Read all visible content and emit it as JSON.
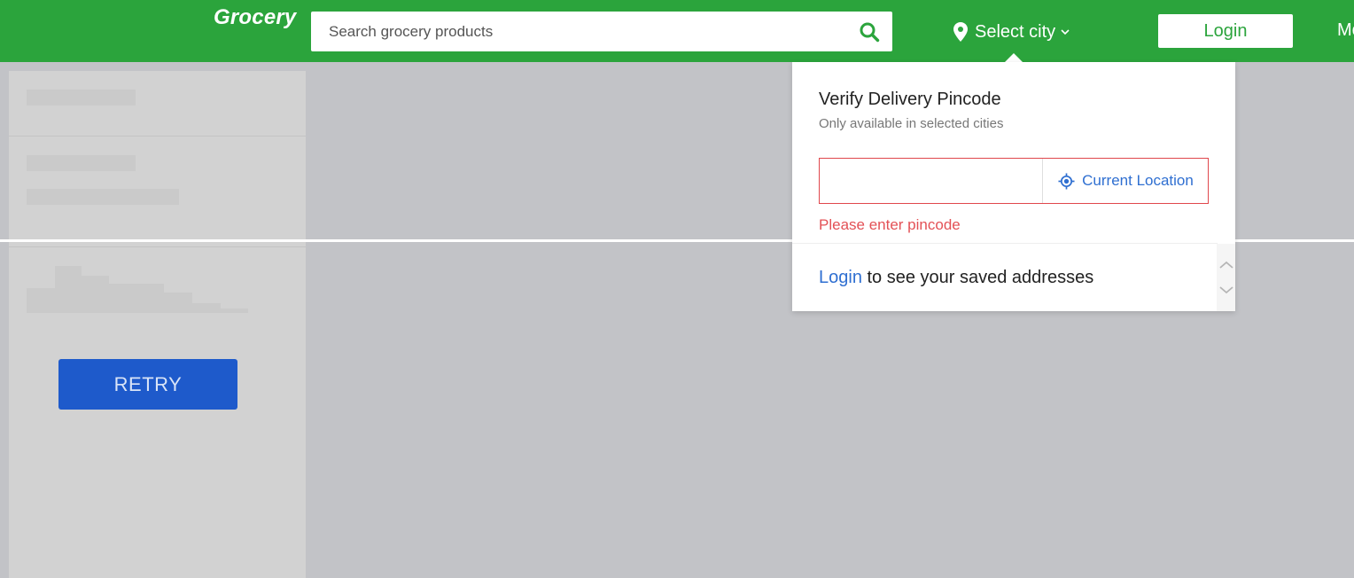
{
  "header": {
    "logo": "Grocery",
    "search": {
      "placeholder": "Search grocery products",
      "value": "",
      "icon": "search-icon"
    },
    "city_select": {
      "label": "Select city",
      "pin_icon": "location-pin-icon",
      "chevron_icon": "chevron-down-icon"
    },
    "login_label": "Login",
    "more_label": "Mo"
  },
  "sidebar": {
    "retry_label": "RETRY"
  },
  "pincode_popup": {
    "title": "Verify Delivery Pincode",
    "subtitle": "Only available in selected cities",
    "pincode_value": "",
    "current_location_label": "Current Location",
    "current_location_icon": "crosshair-icon",
    "error": "Please enter pincode",
    "saved_login_link": "Login",
    "saved_text": " to see your saved addresses"
  },
  "colors": {
    "brand_green": "#2ba43c",
    "link_blue": "#2f6fd1",
    "error_red": "#e35156",
    "retry_blue": "#1e5acb",
    "overlay_gray": "#c2c3c7"
  }
}
